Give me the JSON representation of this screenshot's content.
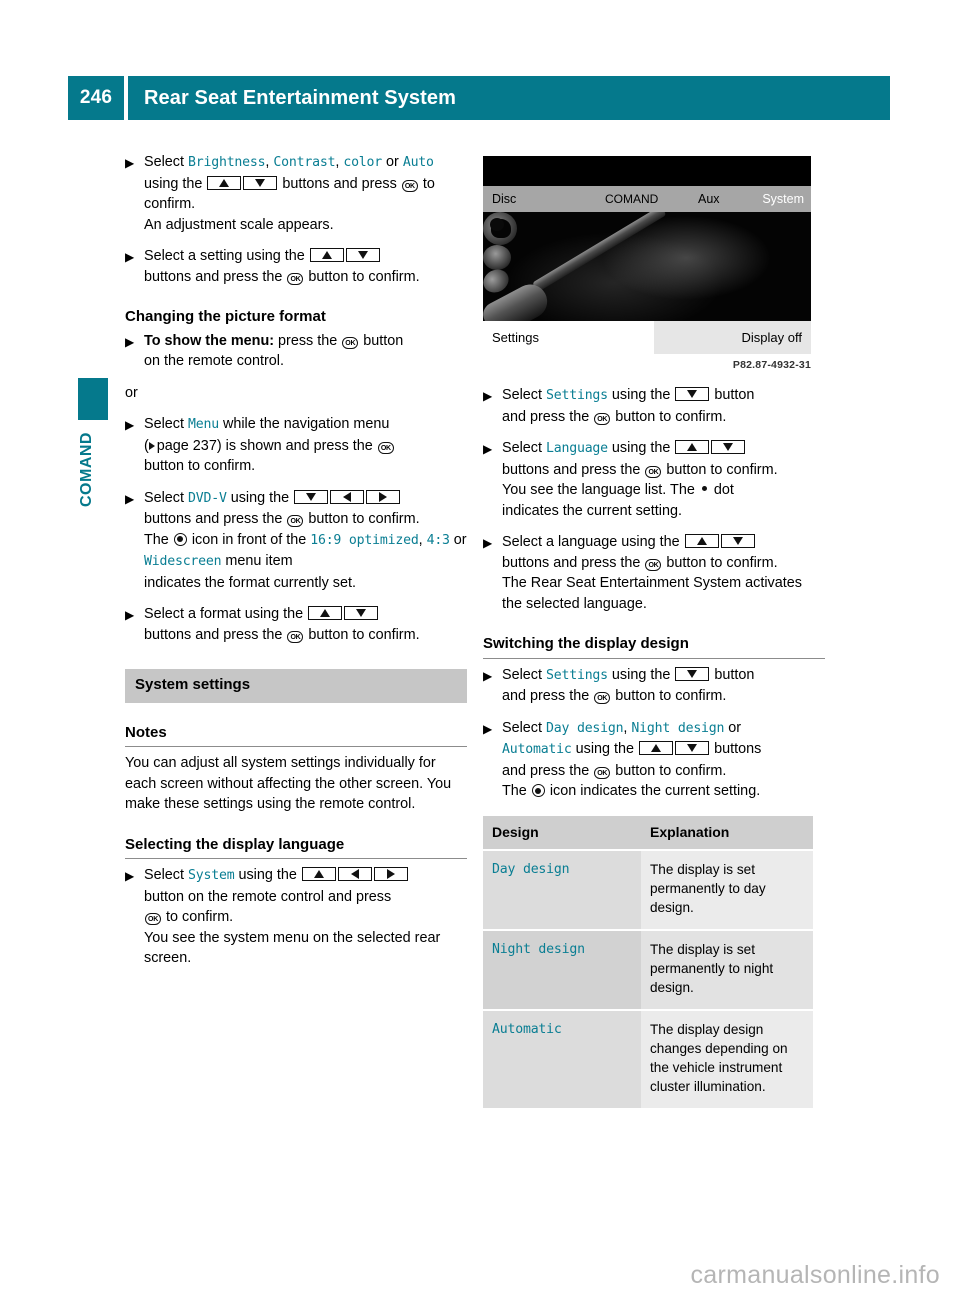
{
  "header": {
    "page_number": "246",
    "title": "Rear Seat Entertainment System",
    "accent_color": "#05798c"
  },
  "chapter_tab": {
    "label": "COMAND"
  },
  "left_column": {
    "step1": {
      "lead": "Select",
      "opt1": "Brightness",
      "sep1": ",",
      "opt2": "Contrast",
      "sep2": ",",
      "opt3": "color",
      "conj": "or",
      "opt4": "Auto",
      "mid": "using the",
      "key_up": "up-arrow-button",
      "key_down": "down-arrow-button",
      "tail1": "buttons and",
      "tail2": "press",
      "ok": "OK",
      "tail3": "to confirm.",
      "result": "An adjustment scale appears."
    },
    "step2": {
      "lead": "Select a setting using the",
      "key_up": "up-arrow-button",
      "key_down": "down-arrow-button",
      "tail1": "buttons and press the",
      "ok": "OK",
      "tail2": "button to confirm."
    },
    "heading_picture_format": "Changing the picture format",
    "step3": {
      "bold_lead": "To show the menu:",
      "rest1": "press the",
      "ok": "OK",
      "rest2": "button",
      "rest3": "on the remote control."
    },
    "or_text": "or",
    "step4": {
      "lead": "Select",
      "item": "Menu",
      "mid": "while the navigation menu",
      "ref_open": "(",
      "ref_text": "page 237",
      "ref_close": ") is shown and press the",
      "ok": "OK",
      "tail": "button to confirm."
    },
    "step5": {
      "lead": "Select",
      "item": "DVD-V",
      "mid": "using the",
      "key_down": "down-arrow-button",
      "key_left": "left-arrow-button",
      "key_right": "right-arrow-button",
      "tail1": "buttons and press the",
      "ok": "OK",
      "tail2": "button to confirm.",
      "tail3": "The",
      "radio": "filled-radio-icon",
      "tail4": "icon in front of the",
      "fmt1": "16:9 optimized",
      "fmt_sep": ",",
      "fmt2": "4:3",
      "fmt_or": "or",
      "fmt3": "Widescreen",
      "tail5": "menu item",
      "tail6": "indicates the format currently set."
    },
    "step6": {
      "lead": "Select a format using the",
      "key_up": "up-arrow-button",
      "key_down": "down-arrow-button",
      "tail1": "buttons and press the",
      "ok": "OK",
      "tail2": "button to confirm."
    },
    "banner_system_settings": "System settings",
    "heading_notes": "Notes",
    "notes_body": "You can adjust all system settings individually for each screen without affecting the other screen. You make these settings using the remote control.",
    "heading_display_language": "Selecting the display language",
    "step7": {
      "lead": "Select",
      "item": "System",
      "mid": "using the",
      "key_up": "up-arrow-button",
      "key_left": "left-arrow-button",
      "key_right": "right-arrow-button",
      "tail1": "button on the remote control and press",
      "ok": "OK",
      "tail2": "to confirm.",
      "tail3": "You see the system menu on the selected rear screen."
    }
  },
  "figure": {
    "top_bar": {
      "disc": "Disc",
      "comand": "COMAND",
      "aux": "Aux",
      "system": "System"
    },
    "bottom_bar": {
      "settings": "Settings",
      "display_off": "Display off"
    },
    "caption": "P82.87-4932-31"
  },
  "right_column": {
    "step1": {
      "lead": "Select",
      "item": "Settings",
      "mid": "using the",
      "key_down": "down-arrow-button",
      "tail1": "button",
      "tail2": "and press the",
      "ok": "OK",
      "tail3": "button to confirm."
    },
    "step2": {
      "lead": "Select",
      "item": "Language",
      "mid": "using the",
      "key_up": "up-arrow-button",
      "key_down": "down-arrow-button",
      "tail1": "buttons and press the",
      "ok": "OK",
      "tail2": "button to confirm.",
      "tail3": "You see the language list. The",
      "dot": "dot-icon",
      "tail4": "dot",
      "tail5": "indicates the current setting."
    },
    "step3": {
      "lead": "Select a language using the",
      "key_up": "up-arrow-button",
      "key_down": "down-arrow-button",
      "tail1": "buttons and press the",
      "ok": "OK",
      "tail2": "button to confirm.",
      "tail3": "The Rear Seat Entertainment System activates the selected language."
    },
    "heading_display_design": "Switching the display design",
    "step4": {
      "lead": "Select",
      "item": "Settings",
      "mid": "using the",
      "key_down": "down-arrow-button",
      "tail1": "button",
      "tail2": "and press the",
      "ok": "OK",
      "tail3": "button to confirm."
    },
    "step5": {
      "lead": "Select",
      "item1": "Day design",
      "sep": ",",
      "item2": "Night design",
      "conj": "or",
      "item3": "Automatic",
      "mid": "using the",
      "key_up": "up-arrow-button",
      "key_down": "down-arrow-button",
      "tail1": "buttons",
      "tail2": "and press the",
      "ok": "OK",
      "tail3": "button to confirm.",
      "tail4": "The",
      "radio": "filled-radio-icon",
      "tail5": "icon indicates the current setting."
    },
    "table": {
      "headers": [
        "Design",
        "Explanation"
      ],
      "rows": [
        {
          "design": "Day design",
          "explanation": "The display is set permanently to day design."
        },
        {
          "design": "Night design",
          "explanation": "The display is set permanently to night design."
        },
        {
          "design": "Automatic",
          "explanation": "The display design changes depending on the vehicle instrument cluster illumination."
        }
      ]
    }
  },
  "footer": {
    "watermark": "carmanualsonline.info"
  }
}
